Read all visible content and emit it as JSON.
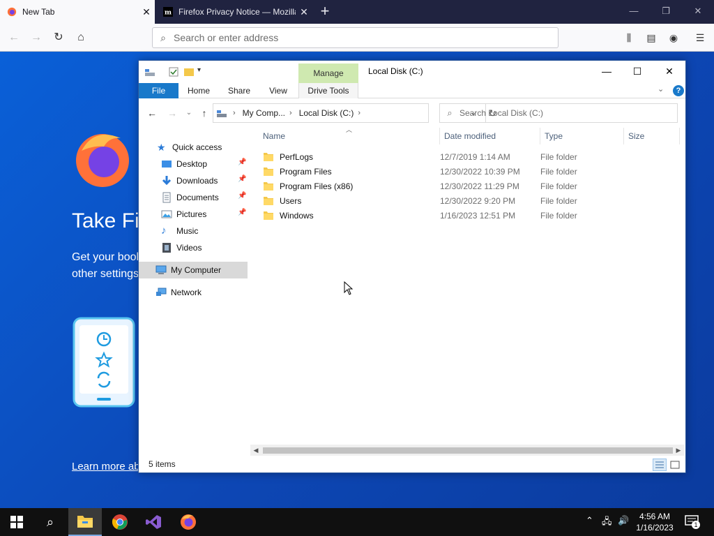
{
  "browser": {
    "tabs": [
      {
        "title": "New Tab",
        "active": true
      },
      {
        "title": "Firefox Privacy Notice — Mozilla",
        "active": false
      }
    ],
    "address_placeholder": "Search or enter address"
  },
  "firefox_page": {
    "headline": "Take Firefox with You",
    "subtext_line1": "Get your bookmarks, history, passwords and",
    "subtext_line2": "other settings on all your devices.",
    "learn_more": "Learn more about Firefox Accounts"
  },
  "explorer": {
    "title": "Local Disk (C:)",
    "manage_label": "Manage",
    "ribbon_tabs": [
      "File",
      "Home",
      "Share",
      "View",
      "Drive Tools"
    ],
    "address": {
      "segments": [
        "My Comp...",
        "Local Disk (C:)"
      ]
    },
    "search_placeholder": "Search Local Disk (C:)",
    "nav": {
      "quick_access": "Quick access",
      "desktop": "Desktop",
      "downloads": "Downloads",
      "documents": "Documents",
      "pictures": "Pictures",
      "music": "Music",
      "videos": "Videos",
      "my_computer": "My Computer",
      "network": "Network"
    },
    "columns": {
      "name": "Name",
      "date": "Date modified",
      "type": "Type",
      "size": "Size"
    },
    "files": [
      {
        "name": "PerfLogs",
        "date": "12/7/2019 1:14 AM",
        "type": "File folder"
      },
      {
        "name": "Program Files",
        "date": "12/30/2022 10:39 PM",
        "type": "File folder"
      },
      {
        "name": "Program Files (x86)",
        "date": "12/30/2022 11:29 PM",
        "type": "File folder"
      },
      {
        "name": "Users",
        "date": "12/30/2022 9:20 PM",
        "type": "File folder"
      },
      {
        "name": "Windows",
        "date": "1/16/2023 12:51 PM",
        "type": "File folder"
      }
    ],
    "status": "5 items"
  },
  "taskbar": {
    "time": "4:56 AM",
    "date": "1/16/2023",
    "notification_count": "1"
  },
  "colors": {
    "file_tab": "#1979ca",
    "manage_tab": "#cfe9b0",
    "folder": "#f4c84a",
    "firefox_bg": "#0d47b5"
  }
}
